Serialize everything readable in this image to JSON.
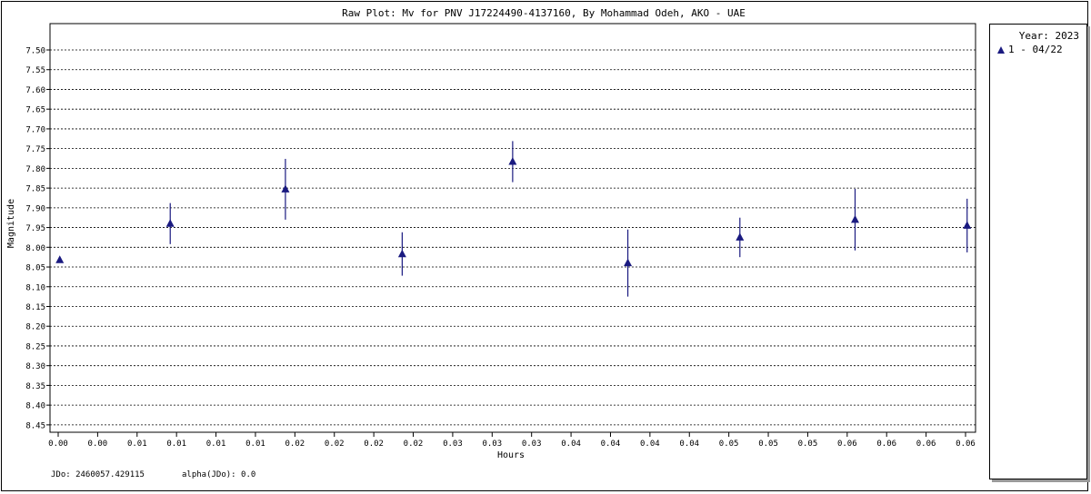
{
  "chart_data": {
    "type": "scatter",
    "title": "Raw Plot: Mv for PNV J17224490-4137160, By Mohammad Odeh, AKO - UAE",
    "xlabel": "Hours",
    "ylabel": "Magnitude",
    "xlim": [
      0,
      0.0575
    ],
    "ylim": [
      8.45,
      7.45
    ],
    "y_inverted": true,
    "grid": "horizontal-dashed",
    "legend_placement": "right",
    "x_tick_labels": [
      "0.00",
      "0.00",
      "0.01",
      "0.01",
      "0.01",
      "0.01",
      "0.02",
      "0.02",
      "0.02",
      "0.02",
      "0.03",
      "0.03",
      "0.03",
      "0.04",
      "0.04",
      "0.04",
      "0.04",
      "0.05",
      "0.05",
      "0.05",
      "0.06",
      "0.06",
      "0.06",
      "0.06"
    ],
    "y_ticks": [
      "7.50",
      "7.55",
      "7.60",
      "7.65",
      "7.70",
      "7.75",
      "7.80",
      "7.85",
      "7.90",
      "7.95",
      "8.00",
      "8.05",
      "8.10",
      "8.15",
      "8.20",
      "8.25",
      "8.30",
      "8.35",
      "8.40",
      "8.45"
    ],
    "series": [
      {
        "name": "1 - 04/22",
        "color": "#1a1a80",
        "marker": "triangle",
        "points": [
          {
            "x": 0.0001,
            "y": 8.032,
            "err": 0.0
          },
          {
            "x": 0.0071,
            "y": 7.94,
            "err": 0.052
          },
          {
            "x": 0.0144,
            "y": 7.853,
            "err": 0.077
          },
          {
            "x": 0.0218,
            "y": 8.017,
            "err": 0.055
          },
          {
            "x": 0.0288,
            "y": 7.783,
            "err": 0.052
          },
          {
            "x": 0.0361,
            "y": 8.04,
            "err": 0.085
          },
          {
            "x": 0.0432,
            "y": 7.975,
            "err": 0.05
          },
          {
            "x": 0.0505,
            "y": 7.93,
            "err": 0.078
          },
          {
            "x": 0.0576,
            "y": 7.945,
            "err": 0.068
          }
        ]
      }
    ]
  },
  "legend": {
    "year": "Year: 2023",
    "entry": "1 - 04/22"
  },
  "footer": {
    "jdo": "JDo: 2460057.429115",
    "alpha": "alpha(JDo): 0.0"
  }
}
